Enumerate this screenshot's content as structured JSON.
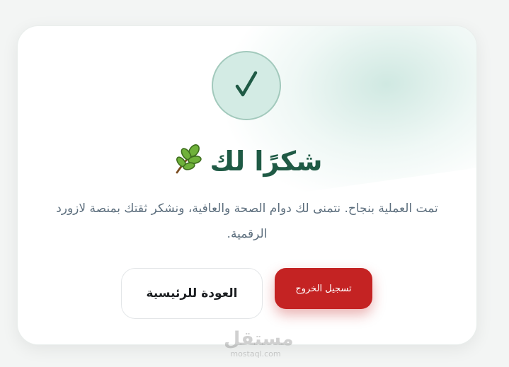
{
  "card": {
    "title": "شكرًا لك",
    "title_emoji": "🌿",
    "title_emoji_icon": "herb-leaf-icon",
    "message": "تمت العملية بنجاح. نتمنى لك دوام الصحة والعافية، ونشكر ثقتك بمنصة لازورد الرقمية.",
    "check_icon": "checkmark-icon",
    "accent_color": "#1f5a45"
  },
  "buttons": {
    "home_label": "العودة للرئيسية",
    "logout_label": "تسجيل الخروج",
    "logout_color": "#c42323"
  },
  "watermark": {
    "brand": "مستقل",
    "domain": "mostaql.com"
  }
}
